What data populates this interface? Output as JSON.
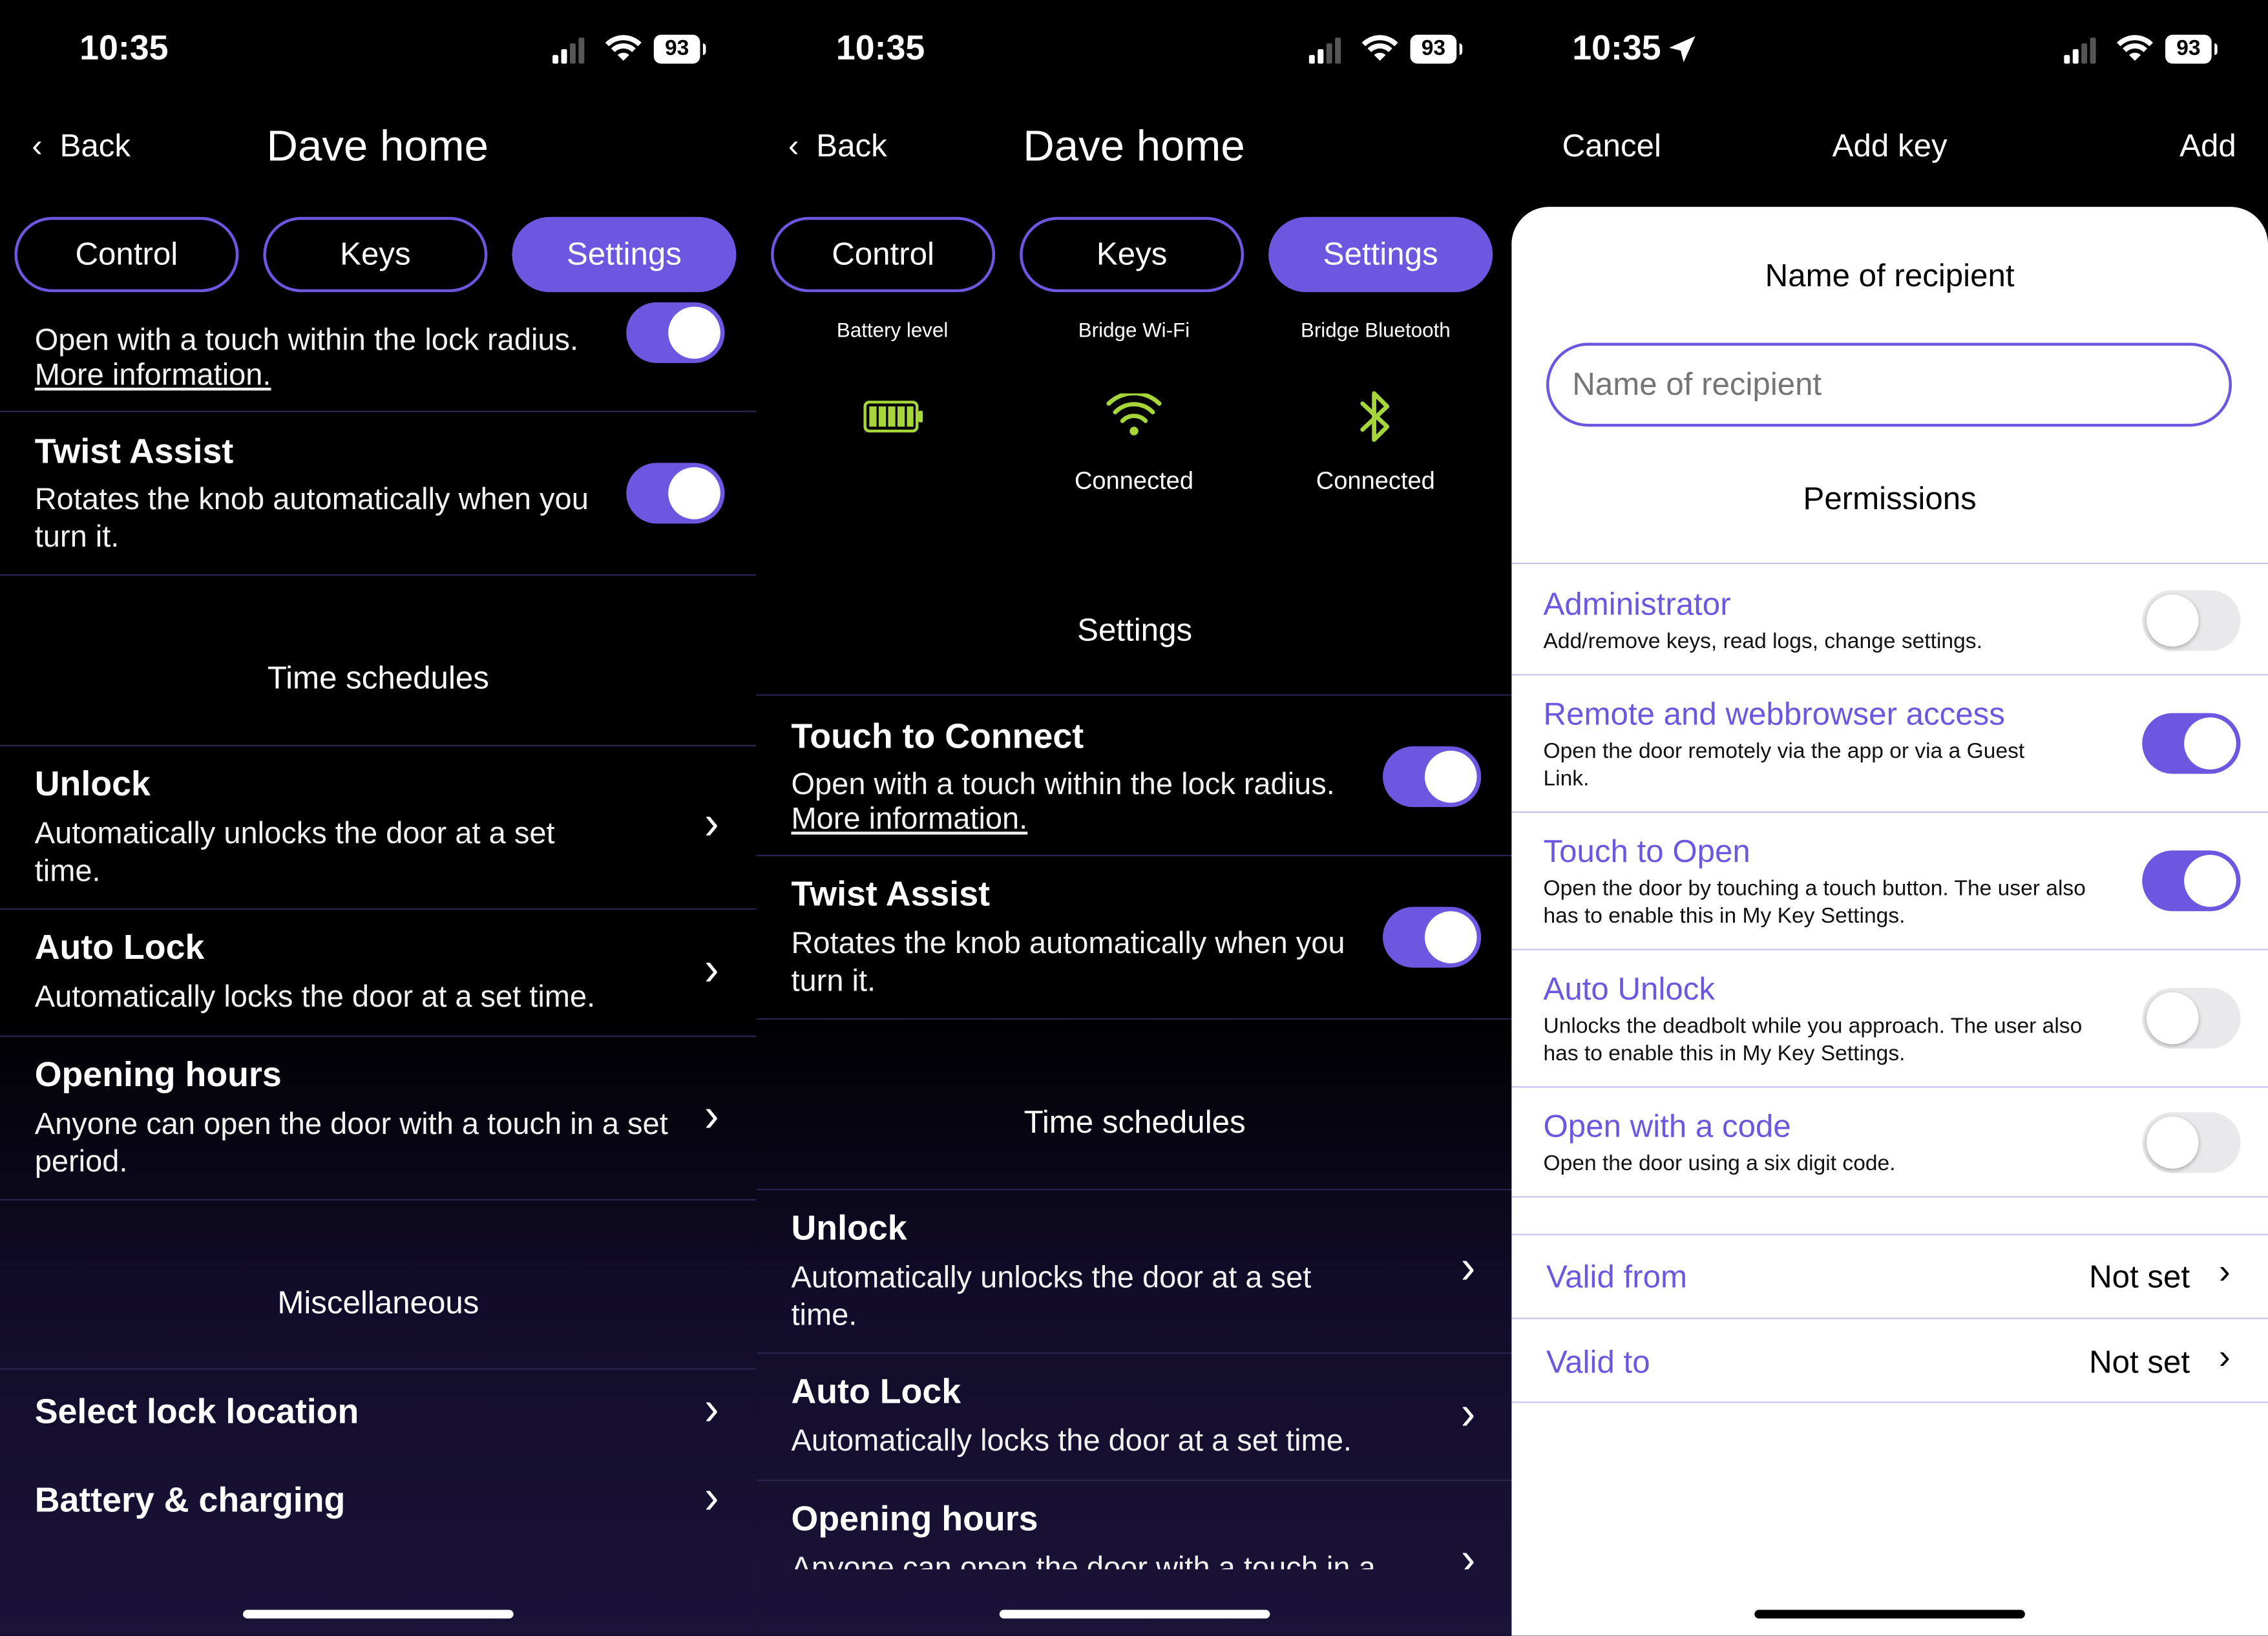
{
  "screens": [
    {
      "status_bar": {
        "time": "10:35",
        "battery": "93"
      },
      "nav": {
        "back_label": "Back",
        "title": "Dave home"
      },
      "tabs": [
        {
          "label": "Control"
        },
        {
          "label": "Keys"
        },
        {
          "label": "Settings",
          "active": true
        }
      ],
      "touch_to_connect": {
        "desc": "Open with a touch within the lock radius.",
        "link": "More information.",
        "enabled": true
      },
      "twist_assist": {
        "title": "Twist Assist",
        "desc": "Rotates the knob automatically when you turn it.",
        "enabled": true
      },
      "time_schedules": {
        "header": "Time schedules",
        "items": [
          {
            "title": "Unlock",
            "desc": "Automatically unlocks the door at a set time."
          },
          {
            "title": "Auto Lock",
            "desc": "Automatically locks the door at a set time."
          },
          {
            "title": "Opening hours",
            "desc": "Anyone can open the door with a touch in a set period."
          }
        ]
      },
      "miscellaneous": {
        "header": "Miscellaneous",
        "items": [
          {
            "title": "Select lock location"
          },
          {
            "title": "Battery & charging"
          }
        ]
      }
    },
    {
      "status_bar": {
        "time": "10:35",
        "battery": "93"
      },
      "nav": {
        "back_label": "Back",
        "title": "Dave home"
      },
      "tabs": [
        {
          "label": "Control"
        },
        {
          "label": "Keys"
        },
        {
          "label": "Settings",
          "active": true
        }
      ],
      "status": [
        {
          "label": "Battery level",
          "icon": "battery-full-icon",
          "value": ""
        },
        {
          "label": "Bridge Wi-Fi",
          "icon": "wifi-icon",
          "value": "Connected"
        },
        {
          "label": "Bridge Bluetooth",
          "icon": "bluetooth-icon",
          "value": "Connected"
        }
      ],
      "settings_header": "Settings",
      "touch_to_connect": {
        "title": "Touch to Connect",
        "desc": "Open with a touch within the lock radius.",
        "link": "More information.",
        "enabled": true
      },
      "twist_assist": {
        "title": "Twist Assist",
        "desc": "Rotates the knob automatically when you turn it.",
        "enabled": true
      },
      "time_schedules": {
        "header": "Time schedules",
        "items": [
          {
            "title": "Unlock",
            "desc": "Automatically unlocks the door at a set time."
          },
          {
            "title": "Auto Lock",
            "desc": "Automatically locks the door at a set time."
          },
          {
            "title": "Opening hours",
            "desc": "Anyone can open the door with a touch in a"
          }
        ]
      }
    },
    {
      "status_bar": {
        "time": "10:35",
        "battery": "93"
      },
      "nav": {
        "cancel_label": "Cancel",
        "title": "Add key",
        "add_label": "Add"
      },
      "recipient": {
        "header": "Name of recipient",
        "placeholder": "Name of recipient"
      },
      "permissions": {
        "header": "Permissions",
        "items": [
          {
            "title": "Administrator",
            "desc": "Add/remove keys, read logs, change settings.",
            "enabled": false
          },
          {
            "title": "Remote and webbrowser access",
            "desc": "Open the door remotely via the app or via a Guest Link.",
            "enabled": true
          },
          {
            "title": "Touch to Open",
            "desc": "Open the door by touching a touch button. The user also has to enable this in My Key Settings.",
            "enabled": true
          },
          {
            "title": "Auto Unlock",
            "desc": "Unlocks the deadbolt while you approach. The user also has to enable this in My Key Settings.",
            "enabled": false
          },
          {
            "title": "Open with a code",
            "desc": "Open the door using a six digit code.",
            "enabled": false
          }
        ]
      },
      "validity": [
        {
          "label": "Valid from",
          "value": "Not set"
        },
        {
          "label": "Valid to",
          "value": "Not set"
        }
      ]
    }
  ],
  "colors": {
    "accent": "#6e57e0",
    "wifi_green": "#a6d63a",
    "battery_green": "#a6d63a"
  }
}
